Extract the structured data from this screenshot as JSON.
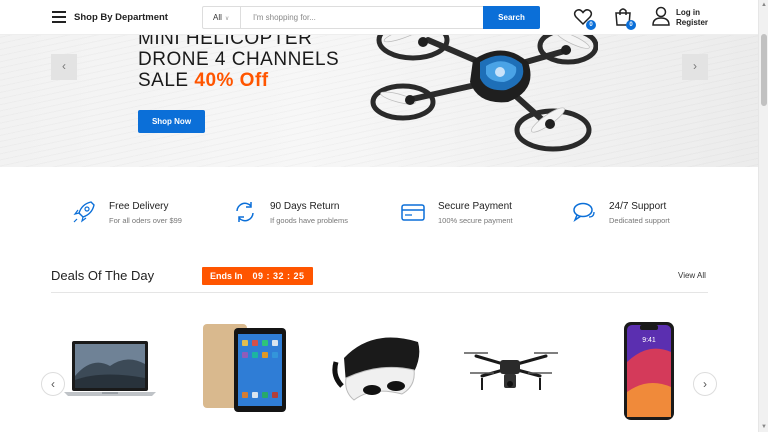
{
  "header": {
    "department_label": "Shop By Department",
    "search_category": "All",
    "search_placeholder": "I'm shopping for...",
    "search_button": "Search",
    "wishlist_count": "0",
    "cart_count": "0",
    "login_label": "Log in",
    "register_label": "Register"
  },
  "hero": {
    "title_line1": "MINI HELICOPTER",
    "title_line2": "DRONE 4 CHANNELS",
    "title_sale": "SALE ",
    "title_discount": "40% Off",
    "cta_label": "Shop Now"
  },
  "features": [
    {
      "title": "Free Delivery",
      "subtitle": "For all oders over $99",
      "icon": "rocket-icon"
    },
    {
      "title": "90 Days Return",
      "subtitle": "If goods have problems",
      "icon": "return-arrows-icon"
    },
    {
      "title": "Secure Payment",
      "subtitle": "100% secure payment",
      "icon": "credit-card-icon"
    },
    {
      "title": "24/7 Support",
      "subtitle": "Dedicated support",
      "icon": "chat-bubbles-icon"
    }
  ],
  "deals": {
    "title": "Deals Of The Day",
    "ends_label": "Ends In",
    "countdown": "09 : 32 : 25",
    "view_all": "View All"
  },
  "products": [
    {
      "name": "laptop"
    },
    {
      "name": "tablet"
    },
    {
      "name": "vr-headset"
    },
    {
      "name": "drone"
    },
    {
      "name": "smartphone"
    }
  ],
  "colors": {
    "accent": "#0b6fd8",
    "sale": "#ff5500",
    "text": "#222222",
    "muted": "#777777"
  }
}
